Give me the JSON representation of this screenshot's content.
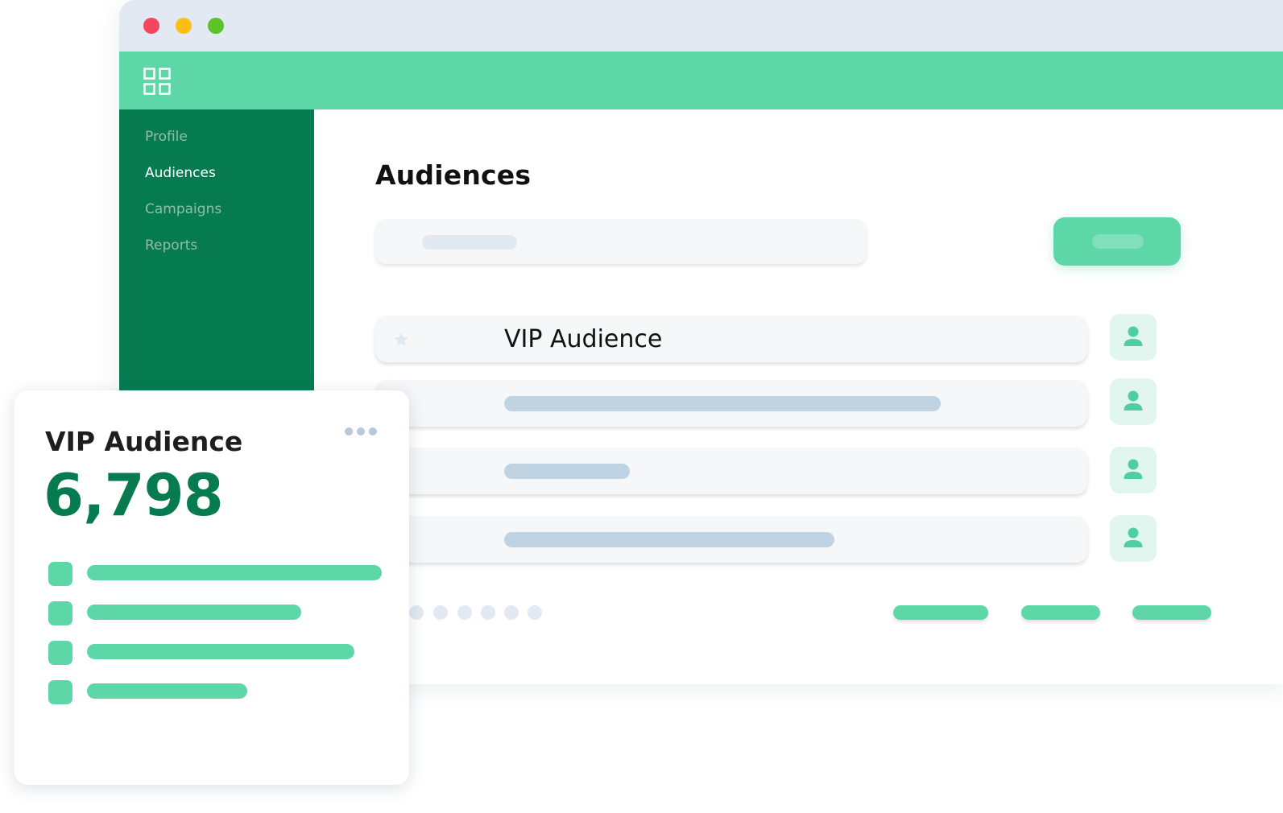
{
  "window": {
    "controls": [
      "close",
      "minimize",
      "maximize"
    ]
  },
  "header": {
    "app_icon": "grid-icon"
  },
  "sidebar": {
    "items": [
      {
        "label": "Profile",
        "active": false
      },
      {
        "label": "Audiences",
        "active": true
      },
      {
        "label": "Campaigns",
        "active": false
      },
      {
        "label": "Reports",
        "active": false
      }
    ]
  },
  "main": {
    "title": "Audiences",
    "rows": [
      {
        "name": "VIP Audience",
        "starred": true
      },
      {
        "name": ""
      },
      {
        "name": ""
      },
      {
        "name": ""
      }
    ],
    "pagination": {
      "pages": 6
    }
  },
  "card": {
    "title": "VIP Audience",
    "count": "6,798",
    "menu_icon": "more-dots-icon"
  },
  "colors": {
    "brand_green": "#077b50",
    "accent_mint": "#5dd6a8",
    "titlebar": "#e3e9f2",
    "placeholder": "#c0d3e2"
  }
}
